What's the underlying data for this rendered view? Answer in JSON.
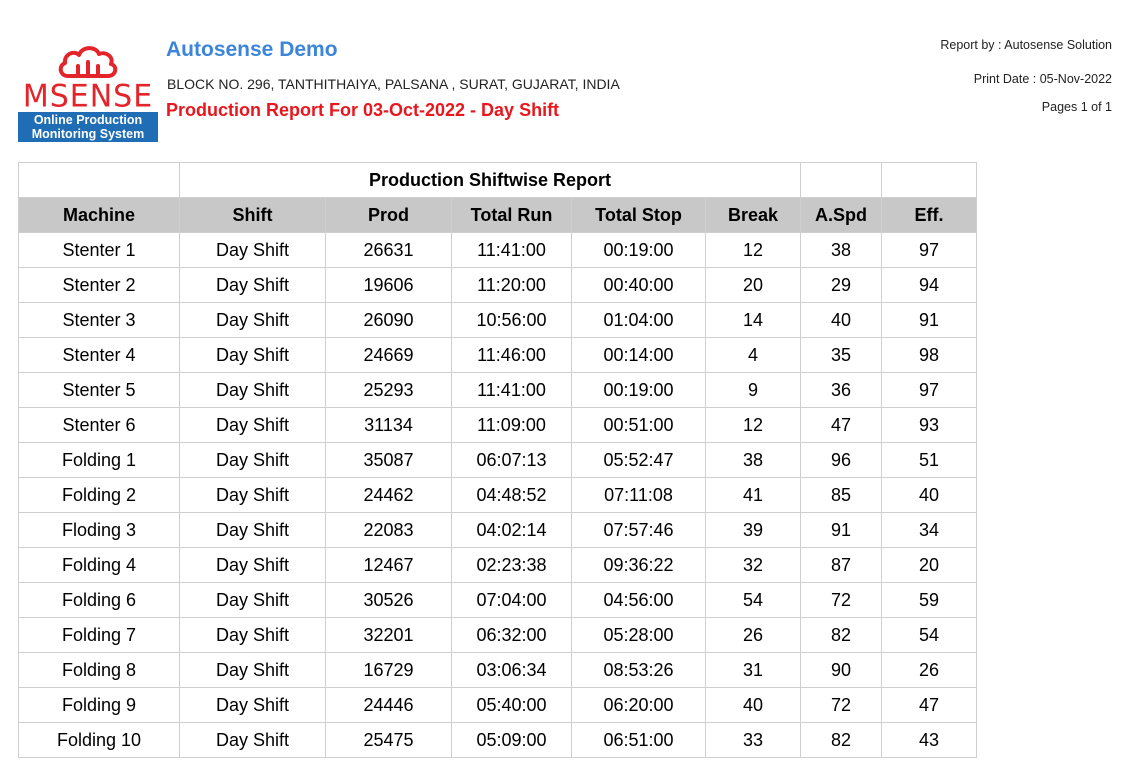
{
  "header": {
    "brand_name": "MSENSE",
    "brand_tagline_line1": "Online Production",
    "brand_tagline_line2": "Monitoring System",
    "company": "Autosense Demo",
    "address": "BLOCK NO. 296, TANTHITHAIYA, PALSANA , SURAT, GUJARAT, INDIA",
    "report_title": "Production Report For 03-Oct-2022 - Day Shift",
    "report_by": "Report by : Autosense Solution",
    "print_date": "Print Date : 05-Nov-2022",
    "pages": "Pages 1 of 1"
  },
  "colors": {
    "company": "#3d85d8",
    "title": "#e8171d",
    "logo_red": "#e3242b",
    "logo_blue": "#1f6db5",
    "header_row": "#c8c8c8"
  },
  "table": {
    "caption": "Production Shiftwise Report",
    "columns": [
      "Machine",
      "Shift",
      "Prod",
      "Total Run",
      "Total Stop",
      "Break",
      "A.Spd",
      "Eff."
    ],
    "rows": [
      [
        "Stenter 1",
        "Day Shift",
        "26631",
        "11:41:00",
        "00:19:00",
        "12",
        "38",
        "97"
      ],
      [
        "Stenter 2",
        "Day Shift",
        "19606",
        "11:20:00",
        "00:40:00",
        "20",
        "29",
        "94"
      ],
      [
        "Stenter 3",
        "Day Shift",
        "26090",
        "10:56:00",
        "01:04:00",
        "14",
        "40",
        "91"
      ],
      [
        "Stenter 4",
        "Day Shift",
        "24669",
        "11:46:00",
        "00:14:00",
        "4",
        "35",
        "98"
      ],
      [
        "Stenter 5",
        "Day Shift",
        "25293",
        "11:41:00",
        "00:19:00",
        "9",
        "36",
        "97"
      ],
      [
        "Stenter 6",
        "Day Shift",
        "31134",
        "11:09:00",
        "00:51:00",
        "12",
        "47",
        "93"
      ],
      [
        "Folding 1",
        "Day Shift",
        "35087",
        "06:07:13",
        "05:52:47",
        "38",
        "96",
        "51"
      ],
      [
        "Folding 2",
        "Day Shift",
        "24462",
        "04:48:52",
        "07:11:08",
        "41",
        "85",
        "40"
      ],
      [
        "Floding 3",
        "Day Shift",
        "22083",
        "04:02:14",
        "07:57:46",
        "39",
        "91",
        "34"
      ],
      [
        "Folding 4",
        "Day Shift",
        "12467",
        "02:23:38",
        "09:36:22",
        "32",
        "87",
        "20"
      ],
      [
        "Folding 6",
        "Day Shift",
        "30526",
        "07:04:00",
        "04:56:00",
        "54",
        "72",
        "59"
      ],
      [
        "Folding 7",
        "Day Shift",
        "32201",
        "06:32:00",
        "05:28:00",
        "26",
        "82",
        "54"
      ],
      [
        "Folding 8",
        "Day Shift",
        "16729",
        "03:06:34",
        "08:53:26",
        "31",
        "90",
        "26"
      ],
      [
        "Folding 9",
        "Day Shift",
        "24446",
        "05:40:00",
        "06:20:00",
        "40",
        "72",
        "47"
      ],
      [
        "Folding 10",
        "Day Shift",
        "25475",
        "05:09:00",
        "06:51:00",
        "33",
        "82",
        "43"
      ]
    ]
  }
}
